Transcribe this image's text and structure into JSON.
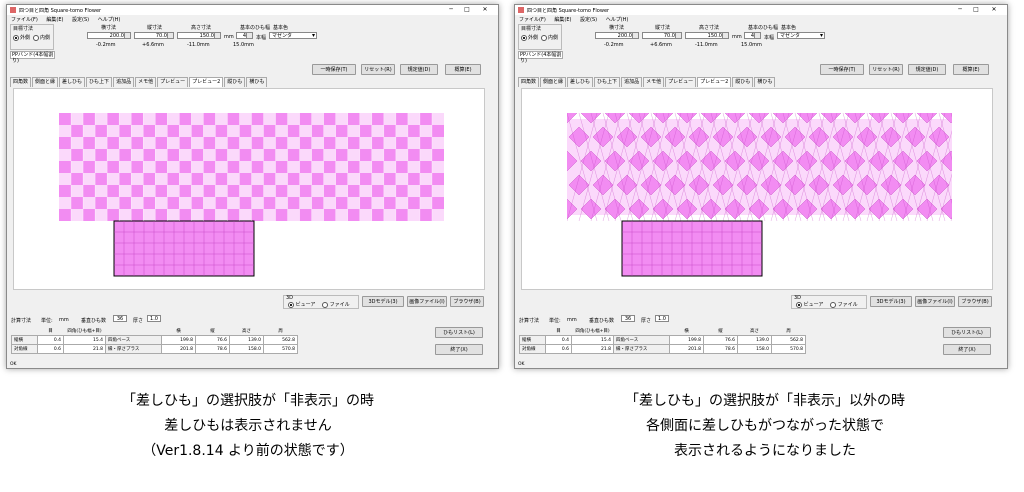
{
  "window": {
    "title": "四つ目と四角 Square-tomo Flower",
    "controls": {
      "minimize": "─",
      "maximize": "□",
      "close": "✕"
    },
    "menu": [
      "ファイル(F)",
      "編集(E)",
      "設定(S)",
      "ヘルプ(H)"
    ]
  },
  "settings": {
    "orientation_label": "目標寸法",
    "outer_label": "外側",
    "inner_label": "内側",
    "width_label": "横寸法",
    "depth_label": "縦寸法",
    "height_label": "高さ寸法",
    "width_value": "200.0",
    "depth_value": "70.0",
    "height_value": "150.0",
    "unit": "mm",
    "strip_width_label": "基本のひも幅",
    "strip_width_value": "4",
    "strip_unit": "本幅",
    "color_label": "基本色",
    "color_value": "マゼンタ",
    "width_diff": "-0.2mm",
    "depth_diff": "+6.6mm",
    "height_diff": "-11.0mm",
    "strip_mm": "15.0mm",
    "band_type": "PPバンド(4本幅割り)"
  },
  "buttons": {
    "temp_save": "一時保存(T)",
    "reset": "リセット(R)",
    "defaults": "規定値(D)",
    "outline": "概算(E)",
    "model_3d": "3Dモデル(3)",
    "image_file": "画像ファイル(I)",
    "browser": "ブラウザ(B)",
    "strip_list": "ひもリスト(L)",
    "exit": "終了(X)"
  },
  "tabs": [
    "四角数",
    "側面と縁",
    "差しひも",
    "ひも上下",
    "追加品",
    "メモ他",
    "プレビュー",
    "プレビュー2",
    "縦ひも",
    "横ひも"
  ],
  "active_tab": "プレビュー2",
  "view_mode": {
    "label": "3D",
    "viewer": "ビューア",
    "file": "ファイル"
  },
  "summary": {
    "dims_label": "計算寸法",
    "unit_label": "単位:",
    "unit": "mm",
    "vertical_count_label": "垂直ひも数",
    "vertical_count": "36",
    "thickness_label": "厚さ",
    "thickness": "1.0"
  },
  "table": {
    "headers": [
      "目",
      "四角(ひも幅+目)",
      "",
      "横",
      "縦",
      "高さ",
      "周"
    ],
    "rows": [
      {
        "label": "縦横",
        "eye": "0.4",
        "square": "15.4",
        "kind": "四角ベース",
        "w": "199.8",
        "d": "76.6",
        "h": "139.0",
        "p": "562.8"
      },
      {
        "label": "対角線",
        "eye": "0.6",
        "square": "21.8",
        "kind": "縁・厚さプラス",
        "w": "201.8",
        "d": "78.6",
        "h": "158.0",
        "p": "570.8"
      }
    ]
  },
  "status": "OK",
  "captions": {
    "left": [
      "「差しひも」の選択肢が「非表示」の時",
      "差しひもは表示されません",
      "（Ver1.8.14 より前の状態です）"
    ],
    "right": [
      "「差しひも」の選択肢が「非表示」以外の時",
      "各側面に差しひもがつながった状態で",
      "表示されるようになりました"
    ]
  },
  "colors": {
    "accent": "#f28cf2",
    "dark": "#c040c0",
    "light": "#fbd9fb"
  }
}
